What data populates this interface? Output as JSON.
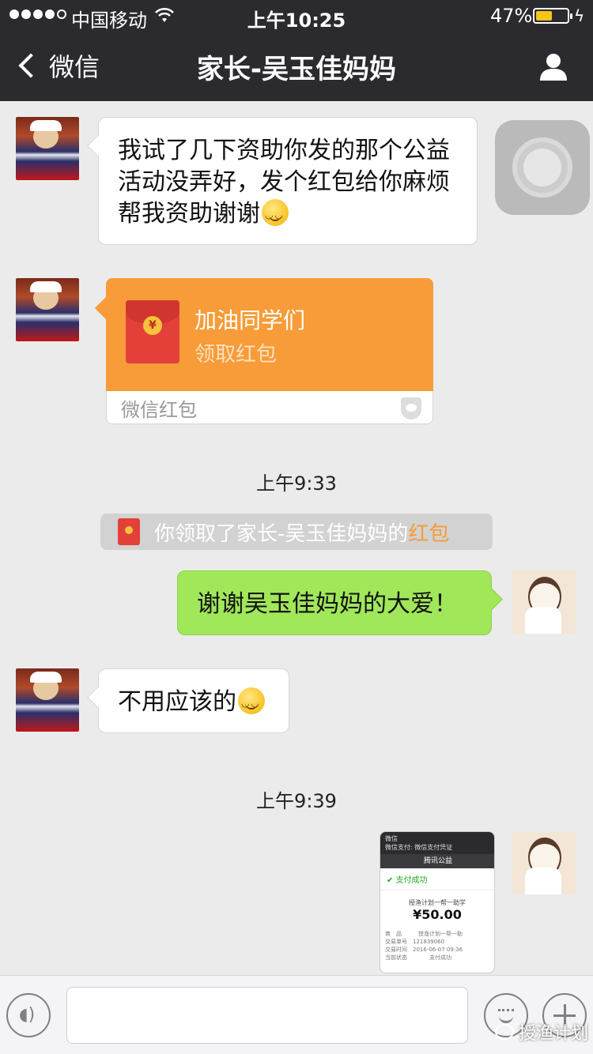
{
  "status": {
    "carrier": "中国移动",
    "time": "上午10:25",
    "battery_pct": "47%"
  },
  "nav": {
    "back_label": "微信",
    "title": "家长-吴玉佳妈妈"
  },
  "messages": {
    "m1": {
      "text": "我试了几下资助你发的那个公益活动没弄好，发个红包给你麻烦帮我资助谢谢"
    },
    "redpacket": {
      "title": "加油同学们",
      "action": "领取红包",
      "brand": "微信红包"
    },
    "ts1": "上午9:33",
    "system": {
      "prefix": "你领取了家长-吴玉佳妈妈的",
      "highlight": "红包"
    },
    "m2": {
      "text": "谢谢吴玉佳妈妈的大爱！"
    },
    "m3": {
      "text": "不用应该的"
    },
    "ts2": "上午9:39",
    "screenshot": {
      "app": "微信",
      "header": "微信支付: 微信支付凭证",
      "merchant": "腾讯公益",
      "status": "支付成功",
      "desc": "授渔计划一帮一助学",
      "amount": "¥50.00",
      "rows": [
        "商　品　　　授渔计划一帮一助",
        "交易单号　121839060",
        "交易时间　2016-06-07 09:36",
        "当前状态　　　　支付成功"
      ]
    }
  },
  "watermark": "授渔计划",
  "colors": {
    "nav_bg": "#2b2b2f",
    "sent_bubble": "#a0e75a",
    "red_packet": "#f79c38",
    "chat_bg": "#ebebeb"
  },
  "icons": [
    "signal-dots",
    "wifi-icon",
    "battery-icon",
    "chevron-left-icon",
    "person-icon",
    "smiley-icon",
    "red-envelope-icon",
    "shield-icon",
    "voice-icon",
    "emoji-icon",
    "plus-icon"
  ]
}
